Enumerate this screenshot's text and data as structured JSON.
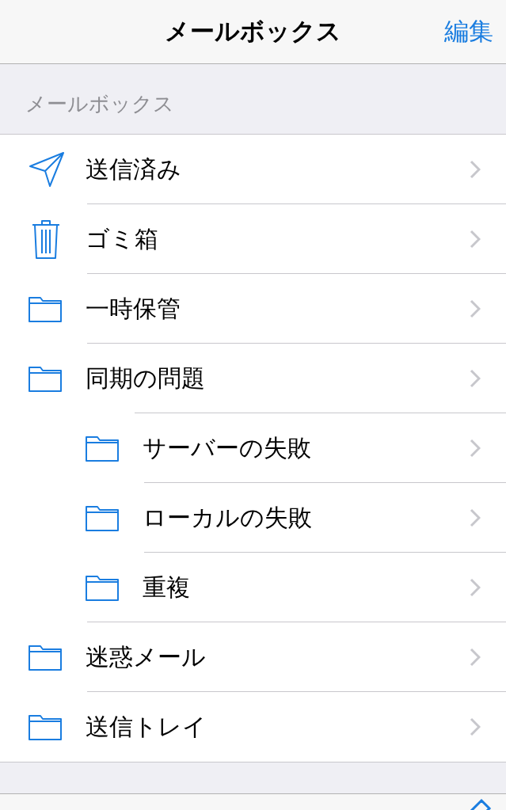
{
  "nav_bar": {
    "title": "メールボックス",
    "edit_button": "編集"
  },
  "section": {
    "header": "メールボックス"
  },
  "mailboxes": [
    {
      "label": "送信済み",
      "kind": "sent"
    },
    {
      "label": "ゴミ箱",
      "kind": "trash"
    },
    {
      "label": "一時保管",
      "kind": "folder"
    },
    {
      "label": "同期の問題",
      "kind": "folder",
      "children": [
        {
          "label": "サーバーの失敗",
          "kind": "folder"
        },
        {
          "label": "ローカルの失敗",
          "kind": "folder"
        },
        {
          "label": "重複",
          "kind": "folder"
        }
      ]
    },
    {
      "label": "迷惑メール",
      "kind": "folder"
    },
    {
      "label": "送信トレイ",
      "kind": "folder"
    }
  ]
}
